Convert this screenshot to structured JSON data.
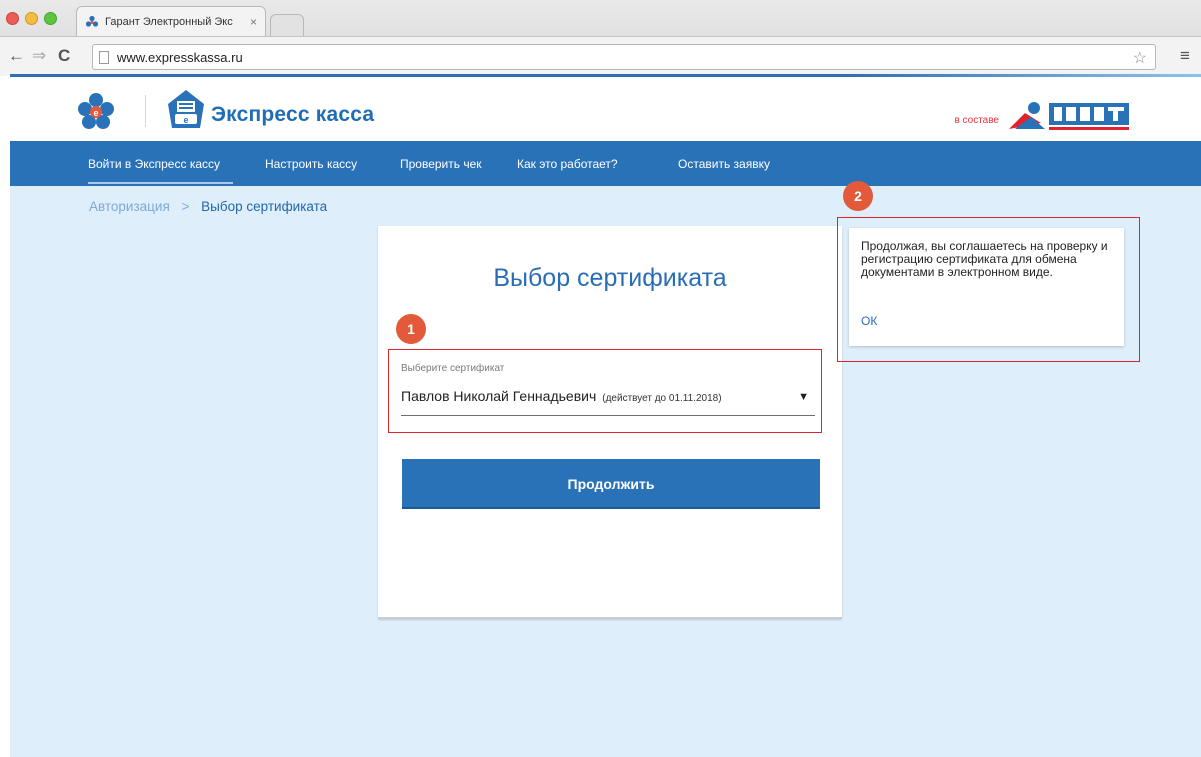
{
  "browser": {
    "tab_title": "Гарант Электронный Экс",
    "tab_close": "×",
    "url": "www.expresskassa.ru",
    "icons": [
      "close-window-icon",
      "minimize-window-icon",
      "maximize-window-icon",
      "back-icon",
      "forward-icon",
      "reload-icon",
      "page-icon",
      "star-icon",
      "menu-icon"
    ]
  },
  "header": {
    "brand": "Экспресс касса",
    "partner_prefix": "в составе",
    "colors": {
      "brand_blue": "#1f6db6",
      "nav_blue": "#2a72b8",
      "accent_red": "#e0242f",
      "page_bg": "#dfeefb"
    }
  },
  "nav": {
    "items": [
      {
        "label": "Войти в Экспресс кассу",
        "active": true
      },
      {
        "label": "Настроить кассу",
        "active": false
      },
      {
        "label": "Проверить чек",
        "active": false
      },
      {
        "label": "Как это работает?",
        "active": false
      },
      {
        "label": "Оставить заявку",
        "active": false
      }
    ]
  },
  "breadcrumb": {
    "parent": "Авторизация",
    "separator": ">",
    "current": "Выбор сертификата"
  },
  "card": {
    "title": "Выбор сертификата",
    "select": {
      "label": "Выберите сертификат",
      "value": "Павлов Николай Геннадьевич",
      "note": "(действует до 01.11.2018)",
      "caret": "▼"
    },
    "continue_label": "Продолжить"
  },
  "annotations": {
    "step1": "1",
    "step2": "2"
  },
  "tooltip": {
    "text": "Продолжая, вы соглашаетесь на проверку и регистрацию сертификата для обмена документами в электронном виде.",
    "ok_label": "ОК"
  }
}
